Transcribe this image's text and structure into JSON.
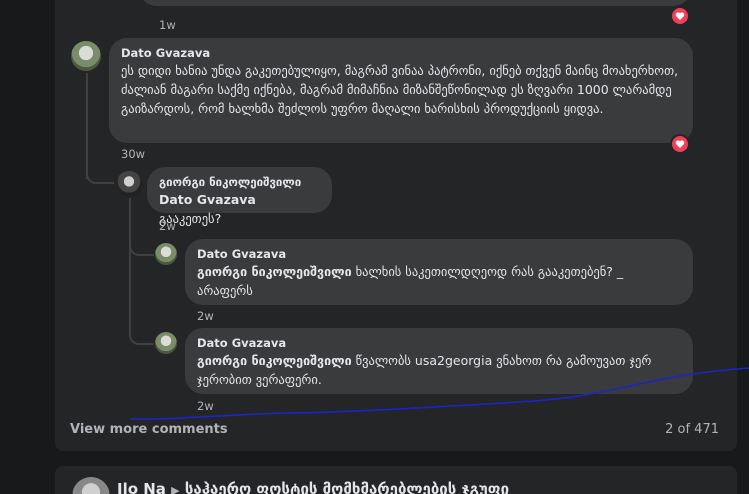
{
  "prev_comment": {
    "time": "1w"
  },
  "comments": [
    {
      "author": "Dato Gvazava",
      "text": "ეს დიდი ხანია უნდა გაკეთებულიყო, მაგრამ ვინაა პატრონი, იქნებ თქვენ მაინც მოახერხოთ, ძალიან მაგარი საქმე იქნება, მაგრამ მიმაჩნია მიზანშეწონილად ეს ზღვარი 1000 ლარამდე გაიზარდოს, რომ ხალხმა შეძლოს უფრო მაღალი ხარისხის პროდუქციის ყიდვა.",
      "time": "30w"
    },
    {
      "author": "გიორგი ნიკოლეიშვილი",
      "mention": "Dato Gvazava",
      "text": " გააკეთეს?",
      "time": "2w"
    },
    {
      "author": "Dato Gvazava",
      "mention": "გიორგი ნიკოლეიშვილი",
      "text": " ხალხის საკეთილდღეოდ რას გააკეთებენ? _ არაფერს",
      "time": "2w"
    },
    {
      "author": "Dato Gvazava",
      "mention": "გიორგი ნიკოლეიშვილი",
      "text": " წვალობს usa2georgia ვნახოთ რა გამოუვათ ჯერ ჯერობით ვერაფერი.",
      "time": "2w"
    }
  ],
  "footer": {
    "view_more": "View more comments",
    "count": "2 of 471"
  },
  "next_post": {
    "author": "Ilo Na",
    "group": "საჰაერო ფოსტის მომხმარებლების ჯგუფი"
  },
  "colors": {
    "bubble": "#3a3b3c",
    "card": "#242526",
    "heart": "#f33e58",
    "annotation": "#1a24c9"
  }
}
